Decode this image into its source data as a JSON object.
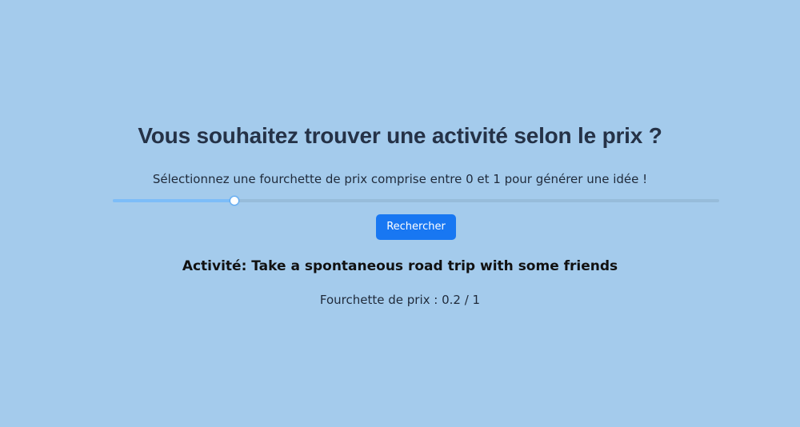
{
  "page": {
    "background_color": "#a4cbec"
  },
  "header": {
    "title": "Vous souhaitez trouver une activité selon le prix ?"
  },
  "form": {
    "instruction": "Sélectionnez une fourchette de prix comprise entre 0 et 1 pour générer une idée !",
    "slider": {
      "min": 0,
      "max": 1,
      "value": 0.2
    },
    "search_button_label": "Rechercher",
    "accent_color": "#1877f2"
  },
  "result": {
    "activity_text": "Activité: Take a spontaneous road trip with some friends",
    "price_range_text": "Fourchette de prix : 0.2 / 1"
  }
}
